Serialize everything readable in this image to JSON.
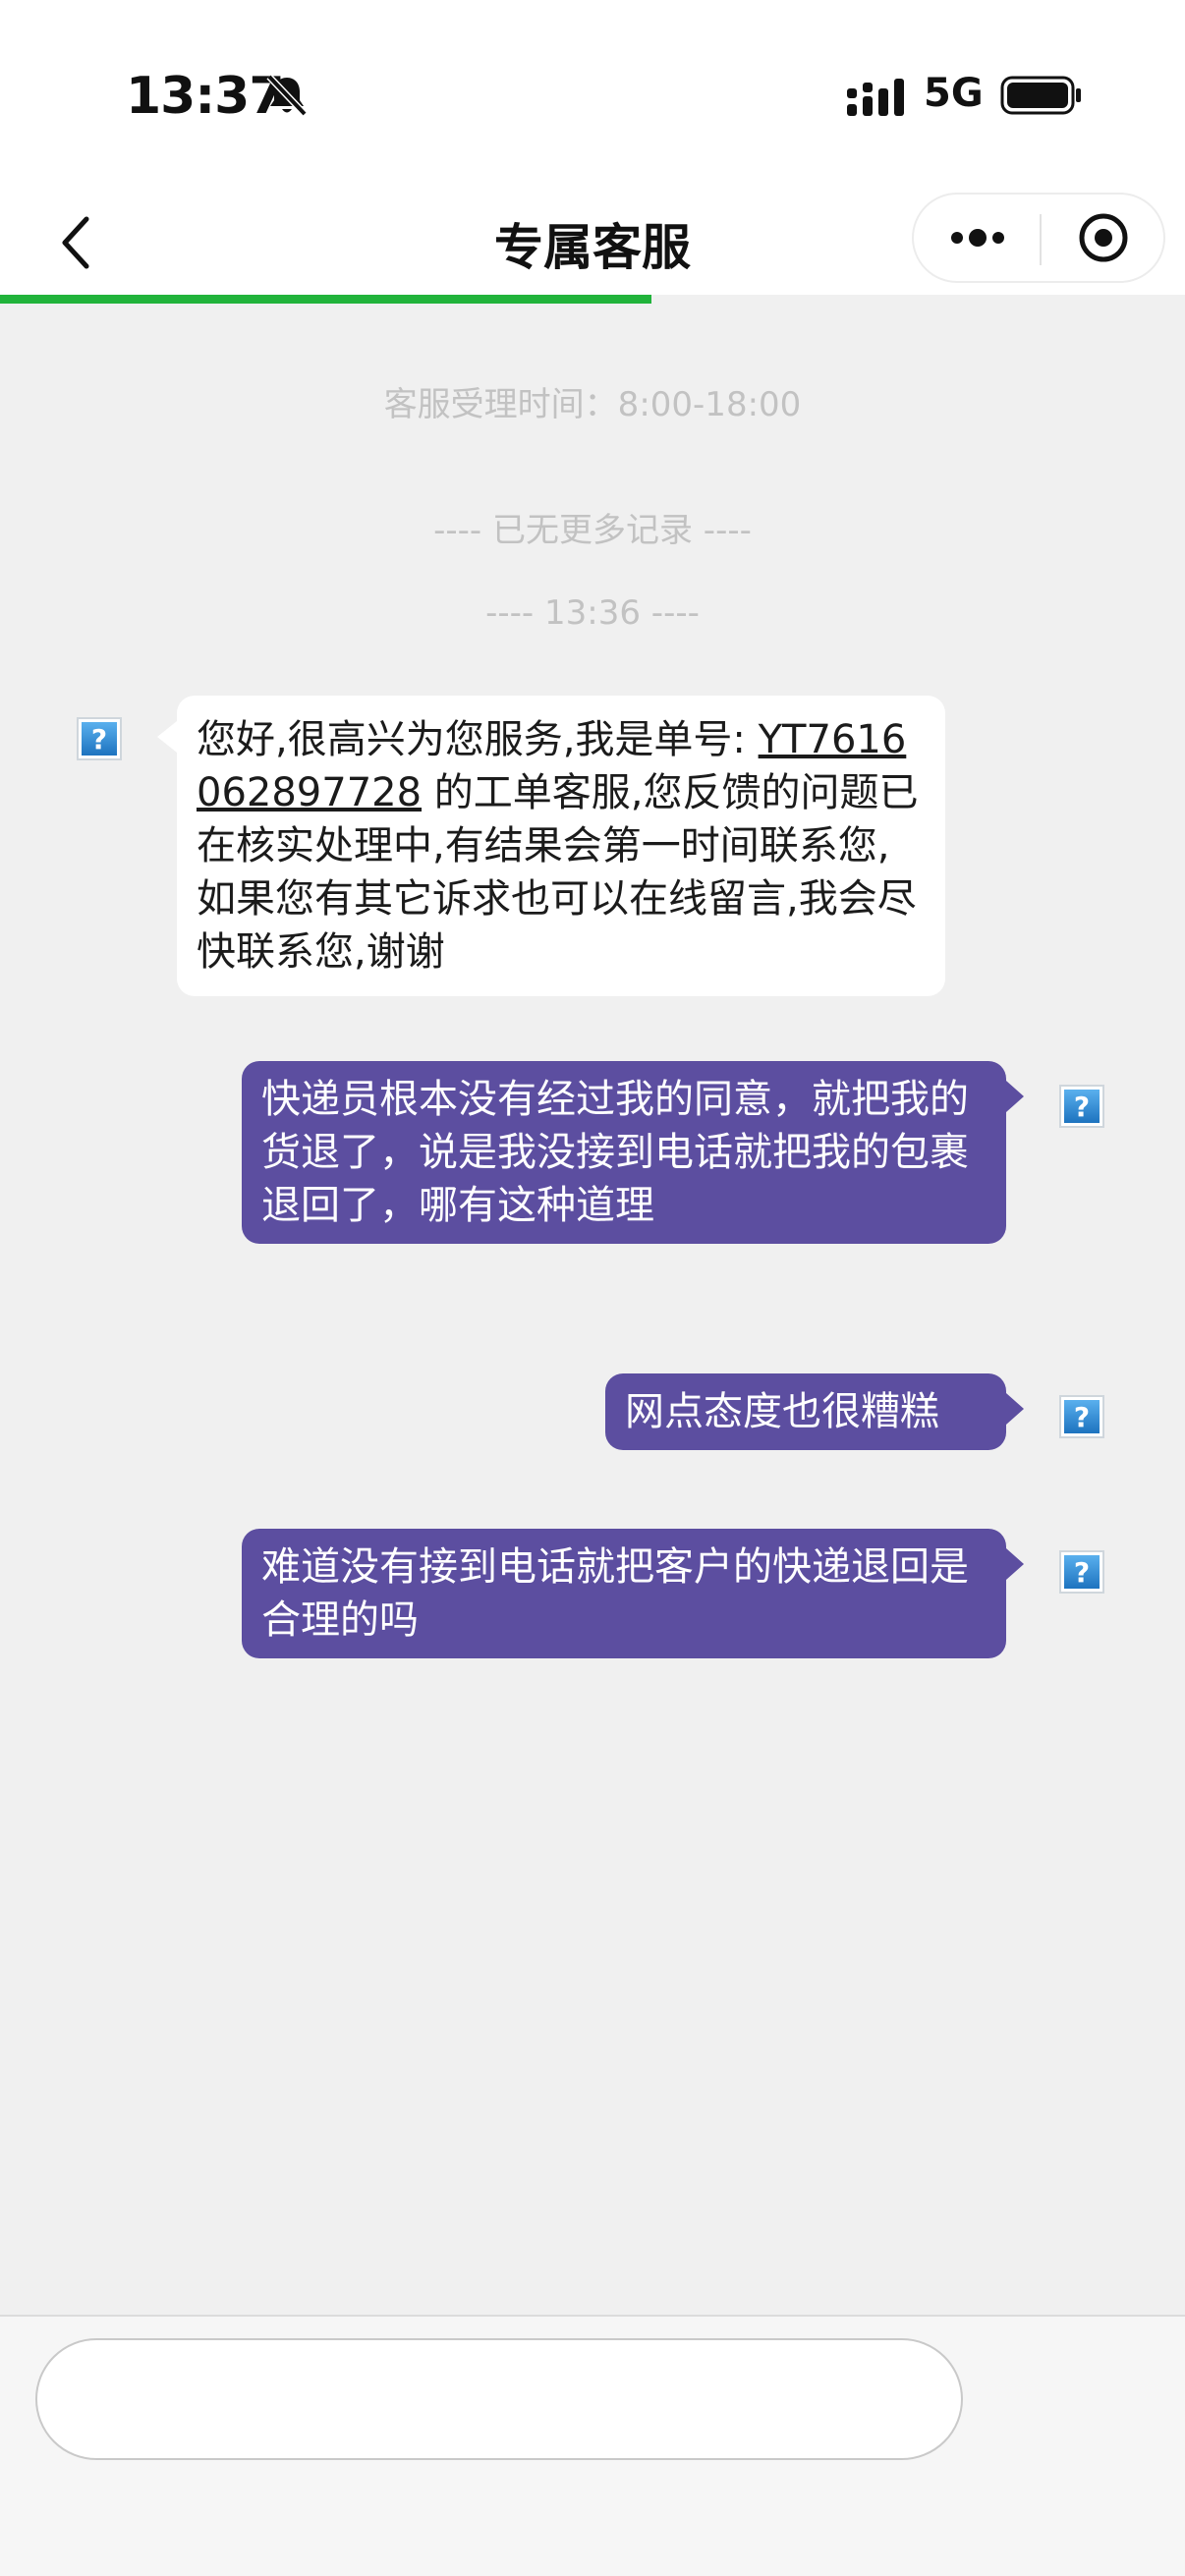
{
  "status_bar": {
    "time": "13:37",
    "network": "5G"
  },
  "nav": {
    "title": "专属客服",
    "load_progress": 0.55
  },
  "chat": {
    "service_hours": "客服受理时间：8:00-18:00",
    "no_more_records": "---- 已无更多记录 ----",
    "time_divider": "---- 13:36 ----",
    "messages": [
      {
        "from": "agent",
        "text_before": "您好,很高兴为您服务,我是单号: ",
        "ticket_no": "YT7616062897728",
        "text_after": " 的工单客服,您反馈的问题已在核实处理中,有结果会第一时间联系您,如果您有其它诉求也可以在线留言,我会尽快联系您,谢谢"
      },
      {
        "from": "user",
        "text": "快递员根本没有经过我的同意，就把我的货退了，说是我没接到电话就把我的包裹退回了，哪有这种道理"
      },
      {
        "from": "user",
        "text": "网点态度也很糟糕"
      },
      {
        "from": "user",
        "text": "难道没有接到电话就把客户的快递退回是合理的吗"
      }
    ]
  },
  "avatar_glyph": "?",
  "input": {
    "value": "",
    "placeholder": ""
  },
  "colors": {
    "accent_progress": "#21b33b",
    "user_bubble": "#5c4ea0",
    "agent_bubble": "#ffffff",
    "background": "#f0f0f0"
  },
  "icons": [
    "bell-slash-icon",
    "signal-bars-icon",
    "battery-icon",
    "back-chevron-icon",
    "more-dots-icon",
    "close-target-icon",
    "broken-image-avatar-icon"
  ]
}
